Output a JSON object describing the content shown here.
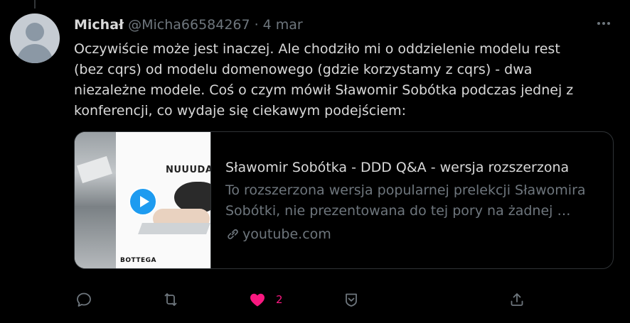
{
  "tweet": {
    "author_name": "Michał",
    "handle": "@Micha66584267",
    "separator": "·",
    "time": "4 mar",
    "text_lines": [
      "Oczywiście może jest inaczej. Ale chodziło mi o oddzielenie modelu rest",
      "(bez cqrs) od modelu domenowego (gdzie korzystamy z cqrs) - dwa",
      "niezależne modele.  Coś o czym mówił  Sławomir Sobótka podczas jednej z",
      "konferencji, co wydaje się ciekawym podejściem:"
    ]
  },
  "card": {
    "title": "Sławomir Sobótka - DDD Q&A - wersja rozszerzona",
    "description_lines": [
      "To rozszerzona wersja popularnej prelekcji Sławomira",
      "Sobótki, nie prezentowana do tej pory na żadnej …"
    ],
    "domain": "youtube.com",
    "thumbnail": {
      "headline": "NUUUDA!",
      "brand": "BOTTEGA"
    }
  },
  "actions": {
    "like_count": "2",
    "icons": [
      "reply-icon",
      "retweet-icon",
      "heart-icon",
      "bookmark-icon",
      "share-icon"
    ],
    "colors": {
      "muted": "#6e767d",
      "liked": "#f91880",
      "accent": "#1d9bf0"
    }
  }
}
